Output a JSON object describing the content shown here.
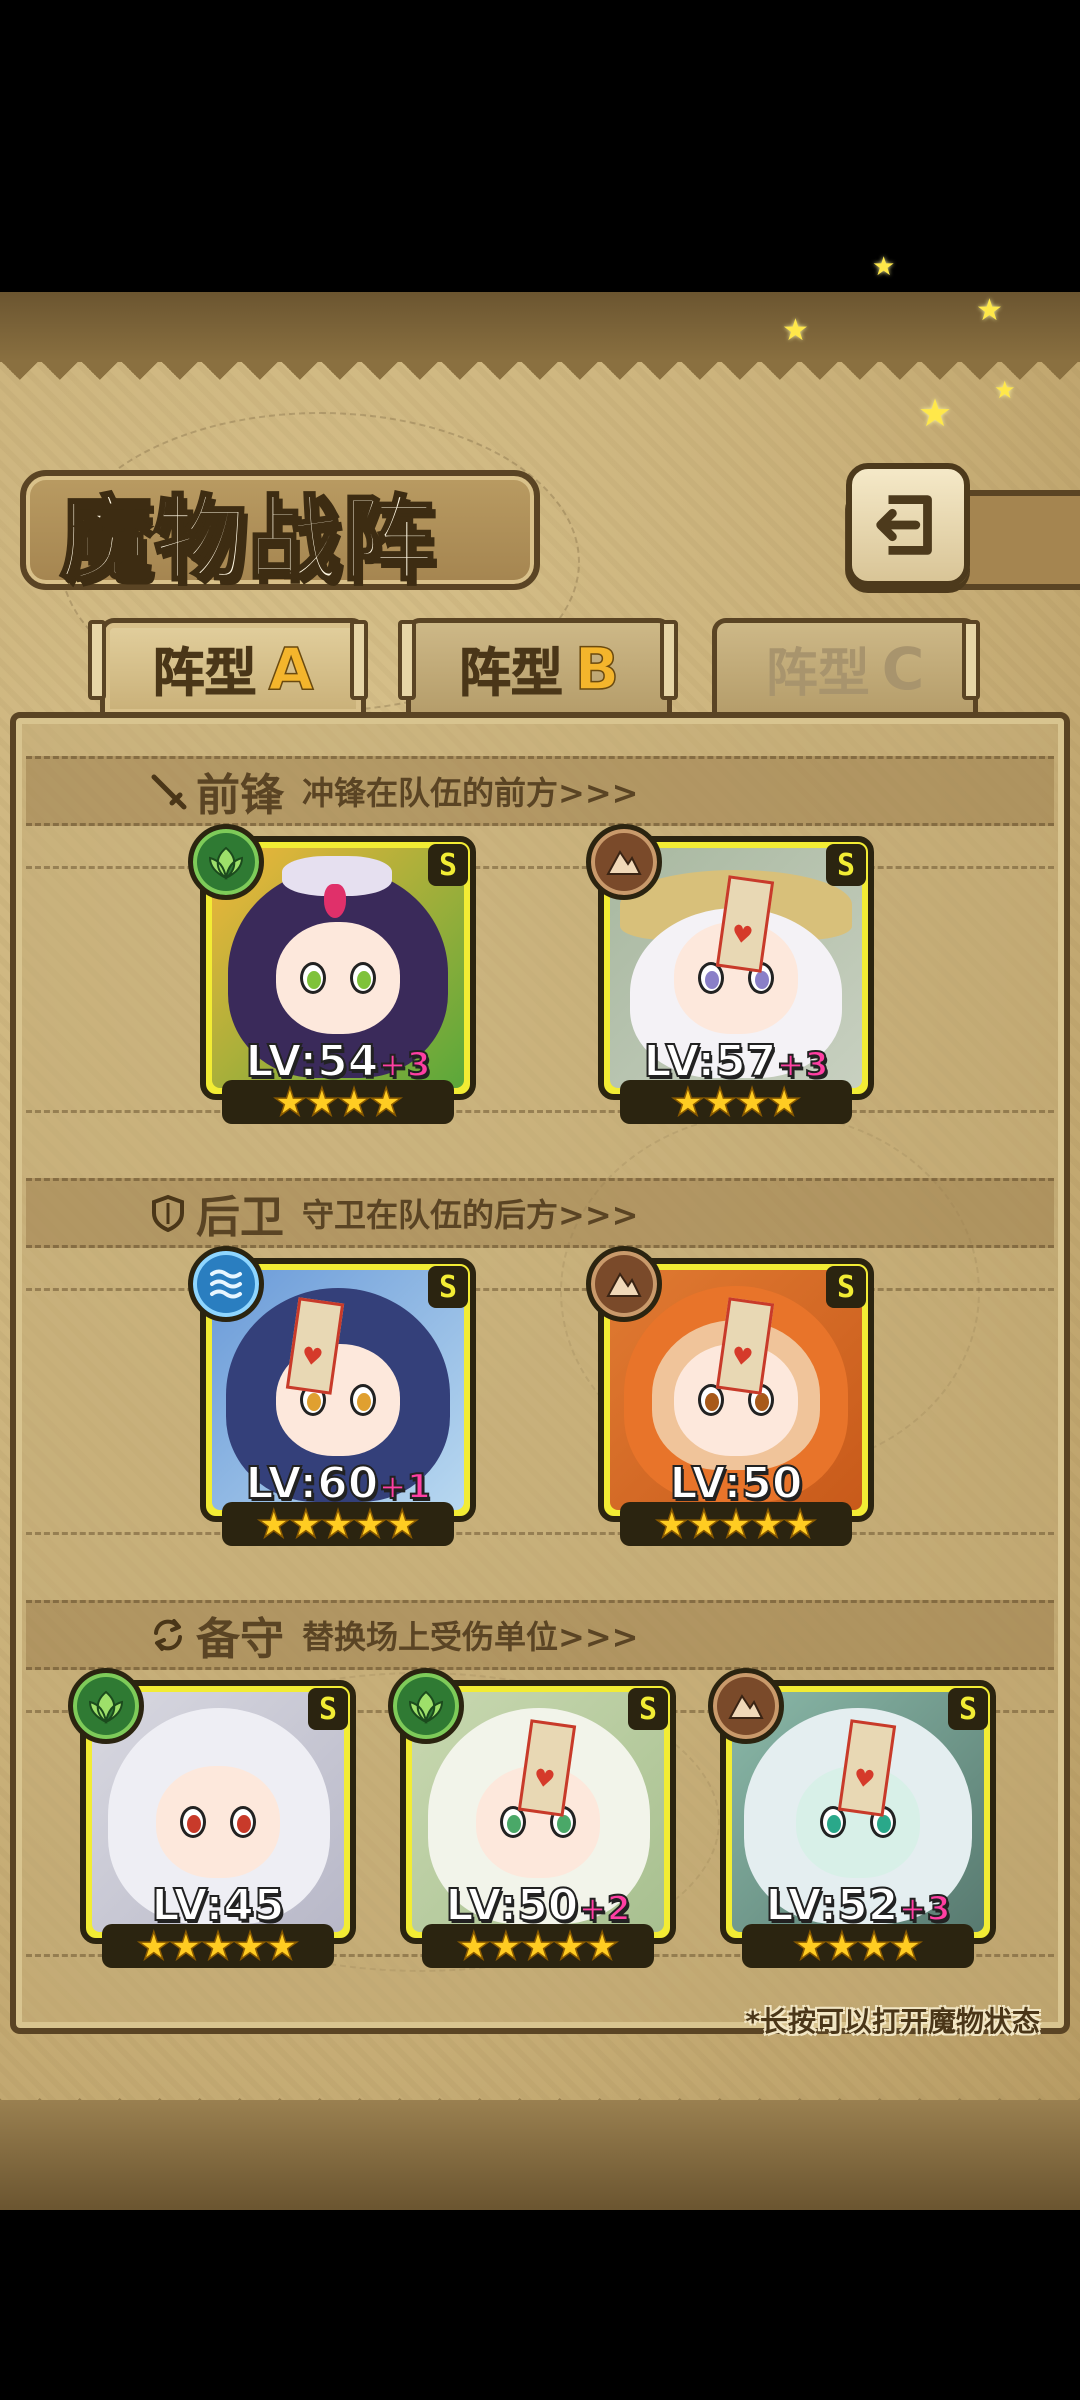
{
  "header": {
    "title": "魔物战阵"
  },
  "tabs": [
    {
      "label": "阵型",
      "letter": "A",
      "active": true
    },
    {
      "label": "阵型",
      "letter": "B",
      "active": false
    },
    {
      "label": "阵型",
      "letter": "C",
      "active": false
    }
  ],
  "sections": {
    "front": {
      "title": "前锋",
      "desc": "冲锋在队伍的前方>>>",
      "icon": "sword-icon"
    },
    "back": {
      "title": "后卫",
      "desc": "守卫在队伍的后方>>>",
      "icon": "shield-icon"
    },
    "reserve": {
      "title": "备守",
      "desc": "替换场上受伤单位>>>",
      "icon": "swap-icon"
    }
  },
  "units": {
    "front": [
      {
        "element": "grass",
        "rank": "S",
        "level": "LV:54",
        "plus": "+3",
        "stars": 4
      },
      {
        "element": "rock",
        "rank": "S",
        "level": "LV:57",
        "plus": "+3",
        "stars": 4
      }
    ],
    "back": [
      {
        "element": "water",
        "rank": "S",
        "level": "LV:60",
        "plus": "+1",
        "stars": 5
      },
      {
        "element": "rock",
        "rank": "S",
        "level": "LV:50",
        "plus": "",
        "stars": 5
      }
    ],
    "reserve": [
      {
        "element": "grass",
        "rank": "S",
        "level": "LV:45",
        "plus": "",
        "stars": 5
      },
      {
        "element": "grass",
        "rank": "S",
        "level": "LV:50",
        "plus": "+2",
        "stars": 5
      },
      {
        "element": "rock",
        "rank": "S",
        "level": "LV:52",
        "plus": "+3",
        "stars": 4
      }
    ]
  },
  "hint": "*长按可以打开魔物状态",
  "colors": {
    "card_frame": "#f2ec34",
    "grass": "#2f7a33",
    "water": "#2a7ec0",
    "rock": "#7a4a2a",
    "level_plus": "#ff3fa3"
  }
}
